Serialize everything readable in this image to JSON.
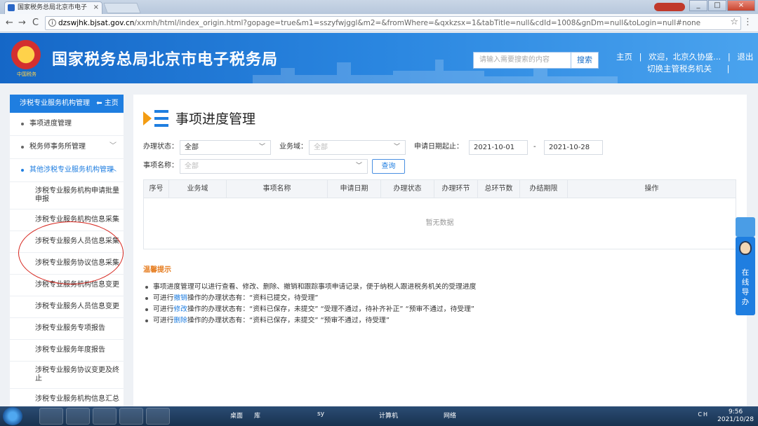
{
  "browser": {
    "tab_title": "国家税务总局北京市电子",
    "tab_close": "×",
    "url_domain": "dzswjhk.bjsat.gov.cn",
    "url_path": "/xxmh/html/index_origin.html?gopage=true&m1=sszyfwjggl&m2=&fromWhere=&qxkzsx=1&tabTitle=null&cdId=1008&gnDm=null&toLogin=null#none",
    "back_icon": "←",
    "forward_icon": "→",
    "reload_icon": "C",
    "star_icon": "☆",
    "menu_icon": "⋮"
  },
  "header": {
    "site_title": "国家税务总局北京市电子税务局",
    "emblem_text": "中国税务",
    "search_placeholder": "请输入需要搜索的内容",
    "search_button": "搜索",
    "nav_home": "主页",
    "nav_sep": "|",
    "welcome": "欢迎，北京久协盛...",
    "logout": "退出",
    "switch_office": "切换主管税务机关"
  },
  "sidebar": {
    "header_label": "涉税专业服务机构管理",
    "home_label": "主页",
    "items": [
      {
        "label": "事项进度管理",
        "chevron": ""
      },
      {
        "label": "税务师事务所管理",
        "chevron": "﹀"
      },
      {
        "label": "其他涉税专业服务机构管理",
        "chevron": "︿"
      }
    ],
    "subitems": [
      "涉税专业服务机构申请批量申报",
      "涉税专业服务机构信息采集",
      "涉税专业服务人员信息采集",
      "涉税专业服务协议信息采集",
      "涉税专业服务机构信息变更",
      "涉税专业服务人员信息变更",
      "涉税专业服务专项报告",
      "涉税专业服务年度报告",
      "涉税专业服务协议变更及终止",
      "涉税专业服务机构信息汇总"
    ]
  },
  "main": {
    "title": "事项进度管理",
    "filters": {
      "status_label": "办理状态：",
      "status_value": "全部",
      "domain_label": "业务域：",
      "domain_placeholder": "全部",
      "date_label": "申请日期起止：",
      "date_from": "2021-10-01",
      "date_sep": "-",
      "date_to": "2021-10-28",
      "name_label": "事项名称：",
      "name_placeholder": "全部",
      "query_button": "查询"
    },
    "table": {
      "columns": [
        "序号",
        "业务域",
        "事项名称",
        "申请日期",
        "办理状态",
        "办理环节",
        "总环节数",
        "办结期限",
        "操作"
      ],
      "empty_text": "暂无数据"
    },
    "tips": {
      "title": "温馨提示",
      "line1": "事项进度管理可以进行查看、修改、删除、撤销和跟踪事项申请记录，便于纳税人跟进税务机关的受理进度",
      "line2_pre": "可进行",
      "line2_link": "撤销",
      "line2_post": "操作的办理状态有：“资料已提交，待受理”",
      "line3_pre": "可进行",
      "line3_link": "修改",
      "line3_post": "操作的办理状态有：“资料已保存，未提交”  “受理不通过，待补齐补正”  “预审不通过，待受理”",
      "line4_pre": "可进行",
      "line4_link": "删除",
      "line4_post": "操作的办理状态有：“资料已保存，未提交”  “预审不通过，待受理”"
    }
  },
  "float_guide": {
    "label_chars": [
      "在",
      "线",
      "导",
      "办"
    ]
  },
  "taskbar": {
    "items": [
      "桌面",
      "库",
      "sy",
      "计算机",
      "网络"
    ],
    "tray_text": "CH",
    "time": "9:56",
    "date": "2021/10/28"
  }
}
